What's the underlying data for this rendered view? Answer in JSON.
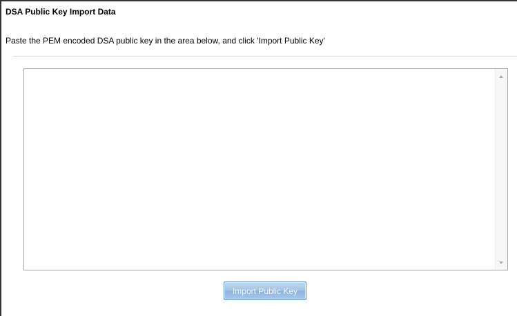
{
  "page": {
    "title": "DSA Public Key Import Data",
    "instructions": "Paste the PEM encoded DSA public key in the area below, and click 'Import Public Key'"
  },
  "key_input": {
    "value": "",
    "placeholder": ""
  },
  "actions": {
    "import_label": "Import Public Key"
  },
  "colors": {
    "button_blue": "#9fc0e4",
    "button_border": "#5a8ec5",
    "frame_border": "#333333"
  },
  "icons": {
    "scroll_up": "scroll-up-arrow-icon",
    "scroll_down": "scroll-down-arrow-icon"
  }
}
